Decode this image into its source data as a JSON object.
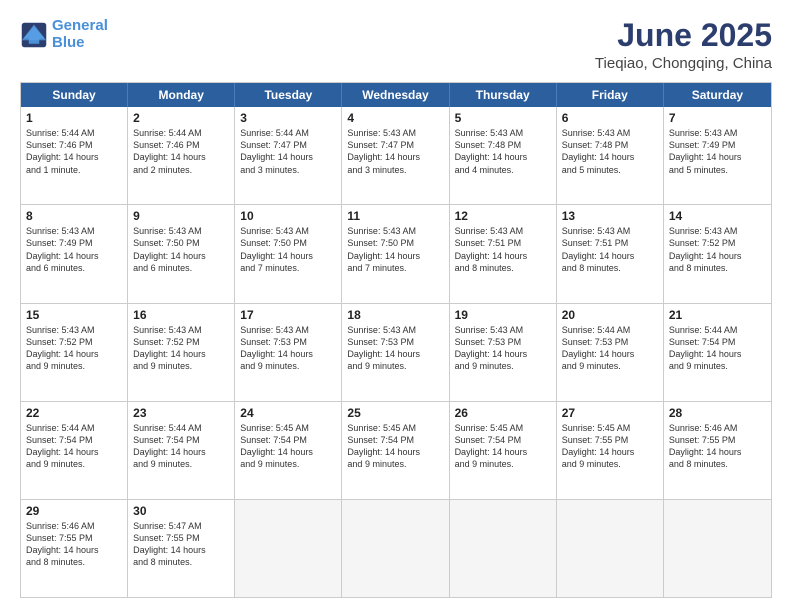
{
  "logo": {
    "line1": "General",
    "line2": "Blue"
  },
  "title": "June 2025",
  "subtitle": "Tieqiao, Chongqing, China",
  "headers": [
    "Sunday",
    "Monday",
    "Tuesday",
    "Wednesday",
    "Thursday",
    "Friday",
    "Saturday"
  ],
  "weeks": [
    [
      {
        "day": "1",
        "info": "Sunrise: 5:44 AM\nSunset: 7:46 PM\nDaylight: 14 hours\nand 1 minute."
      },
      {
        "day": "2",
        "info": "Sunrise: 5:44 AM\nSunset: 7:46 PM\nDaylight: 14 hours\nand 2 minutes."
      },
      {
        "day": "3",
        "info": "Sunrise: 5:44 AM\nSunset: 7:47 PM\nDaylight: 14 hours\nand 3 minutes."
      },
      {
        "day": "4",
        "info": "Sunrise: 5:43 AM\nSunset: 7:47 PM\nDaylight: 14 hours\nand 3 minutes."
      },
      {
        "day": "5",
        "info": "Sunrise: 5:43 AM\nSunset: 7:48 PM\nDaylight: 14 hours\nand 4 minutes."
      },
      {
        "day": "6",
        "info": "Sunrise: 5:43 AM\nSunset: 7:48 PM\nDaylight: 14 hours\nand 5 minutes."
      },
      {
        "day": "7",
        "info": "Sunrise: 5:43 AM\nSunset: 7:49 PM\nDaylight: 14 hours\nand 5 minutes."
      }
    ],
    [
      {
        "day": "8",
        "info": "Sunrise: 5:43 AM\nSunset: 7:49 PM\nDaylight: 14 hours\nand 6 minutes."
      },
      {
        "day": "9",
        "info": "Sunrise: 5:43 AM\nSunset: 7:50 PM\nDaylight: 14 hours\nand 6 minutes."
      },
      {
        "day": "10",
        "info": "Sunrise: 5:43 AM\nSunset: 7:50 PM\nDaylight: 14 hours\nand 7 minutes."
      },
      {
        "day": "11",
        "info": "Sunrise: 5:43 AM\nSunset: 7:50 PM\nDaylight: 14 hours\nand 7 minutes."
      },
      {
        "day": "12",
        "info": "Sunrise: 5:43 AM\nSunset: 7:51 PM\nDaylight: 14 hours\nand 8 minutes."
      },
      {
        "day": "13",
        "info": "Sunrise: 5:43 AM\nSunset: 7:51 PM\nDaylight: 14 hours\nand 8 minutes."
      },
      {
        "day": "14",
        "info": "Sunrise: 5:43 AM\nSunset: 7:52 PM\nDaylight: 14 hours\nand 8 minutes."
      }
    ],
    [
      {
        "day": "15",
        "info": "Sunrise: 5:43 AM\nSunset: 7:52 PM\nDaylight: 14 hours\nand 9 minutes."
      },
      {
        "day": "16",
        "info": "Sunrise: 5:43 AM\nSunset: 7:52 PM\nDaylight: 14 hours\nand 9 minutes."
      },
      {
        "day": "17",
        "info": "Sunrise: 5:43 AM\nSunset: 7:53 PM\nDaylight: 14 hours\nand 9 minutes."
      },
      {
        "day": "18",
        "info": "Sunrise: 5:43 AM\nSunset: 7:53 PM\nDaylight: 14 hours\nand 9 minutes."
      },
      {
        "day": "19",
        "info": "Sunrise: 5:43 AM\nSunset: 7:53 PM\nDaylight: 14 hours\nand 9 minutes."
      },
      {
        "day": "20",
        "info": "Sunrise: 5:44 AM\nSunset: 7:53 PM\nDaylight: 14 hours\nand 9 minutes."
      },
      {
        "day": "21",
        "info": "Sunrise: 5:44 AM\nSunset: 7:54 PM\nDaylight: 14 hours\nand 9 minutes."
      }
    ],
    [
      {
        "day": "22",
        "info": "Sunrise: 5:44 AM\nSunset: 7:54 PM\nDaylight: 14 hours\nand 9 minutes."
      },
      {
        "day": "23",
        "info": "Sunrise: 5:44 AM\nSunset: 7:54 PM\nDaylight: 14 hours\nand 9 minutes."
      },
      {
        "day": "24",
        "info": "Sunrise: 5:45 AM\nSunset: 7:54 PM\nDaylight: 14 hours\nand 9 minutes."
      },
      {
        "day": "25",
        "info": "Sunrise: 5:45 AM\nSunset: 7:54 PM\nDaylight: 14 hours\nand 9 minutes."
      },
      {
        "day": "26",
        "info": "Sunrise: 5:45 AM\nSunset: 7:54 PM\nDaylight: 14 hours\nand 9 minutes."
      },
      {
        "day": "27",
        "info": "Sunrise: 5:45 AM\nSunset: 7:55 PM\nDaylight: 14 hours\nand 9 minutes."
      },
      {
        "day": "28",
        "info": "Sunrise: 5:46 AM\nSunset: 7:55 PM\nDaylight: 14 hours\nand 8 minutes."
      }
    ],
    [
      {
        "day": "29",
        "info": "Sunrise: 5:46 AM\nSunset: 7:55 PM\nDaylight: 14 hours\nand 8 minutes."
      },
      {
        "day": "30",
        "info": "Sunrise: 5:47 AM\nSunset: 7:55 PM\nDaylight: 14 hours\nand 8 minutes."
      },
      {
        "day": "",
        "info": ""
      },
      {
        "day": "",
        "info": ""
      },
      {
        "day": "",
        "info": ""
      },
      {
        "day": "",
        "info": ""
      },
      {
        "day": "",
        "info": ""
      }
    ]
  ]
}
